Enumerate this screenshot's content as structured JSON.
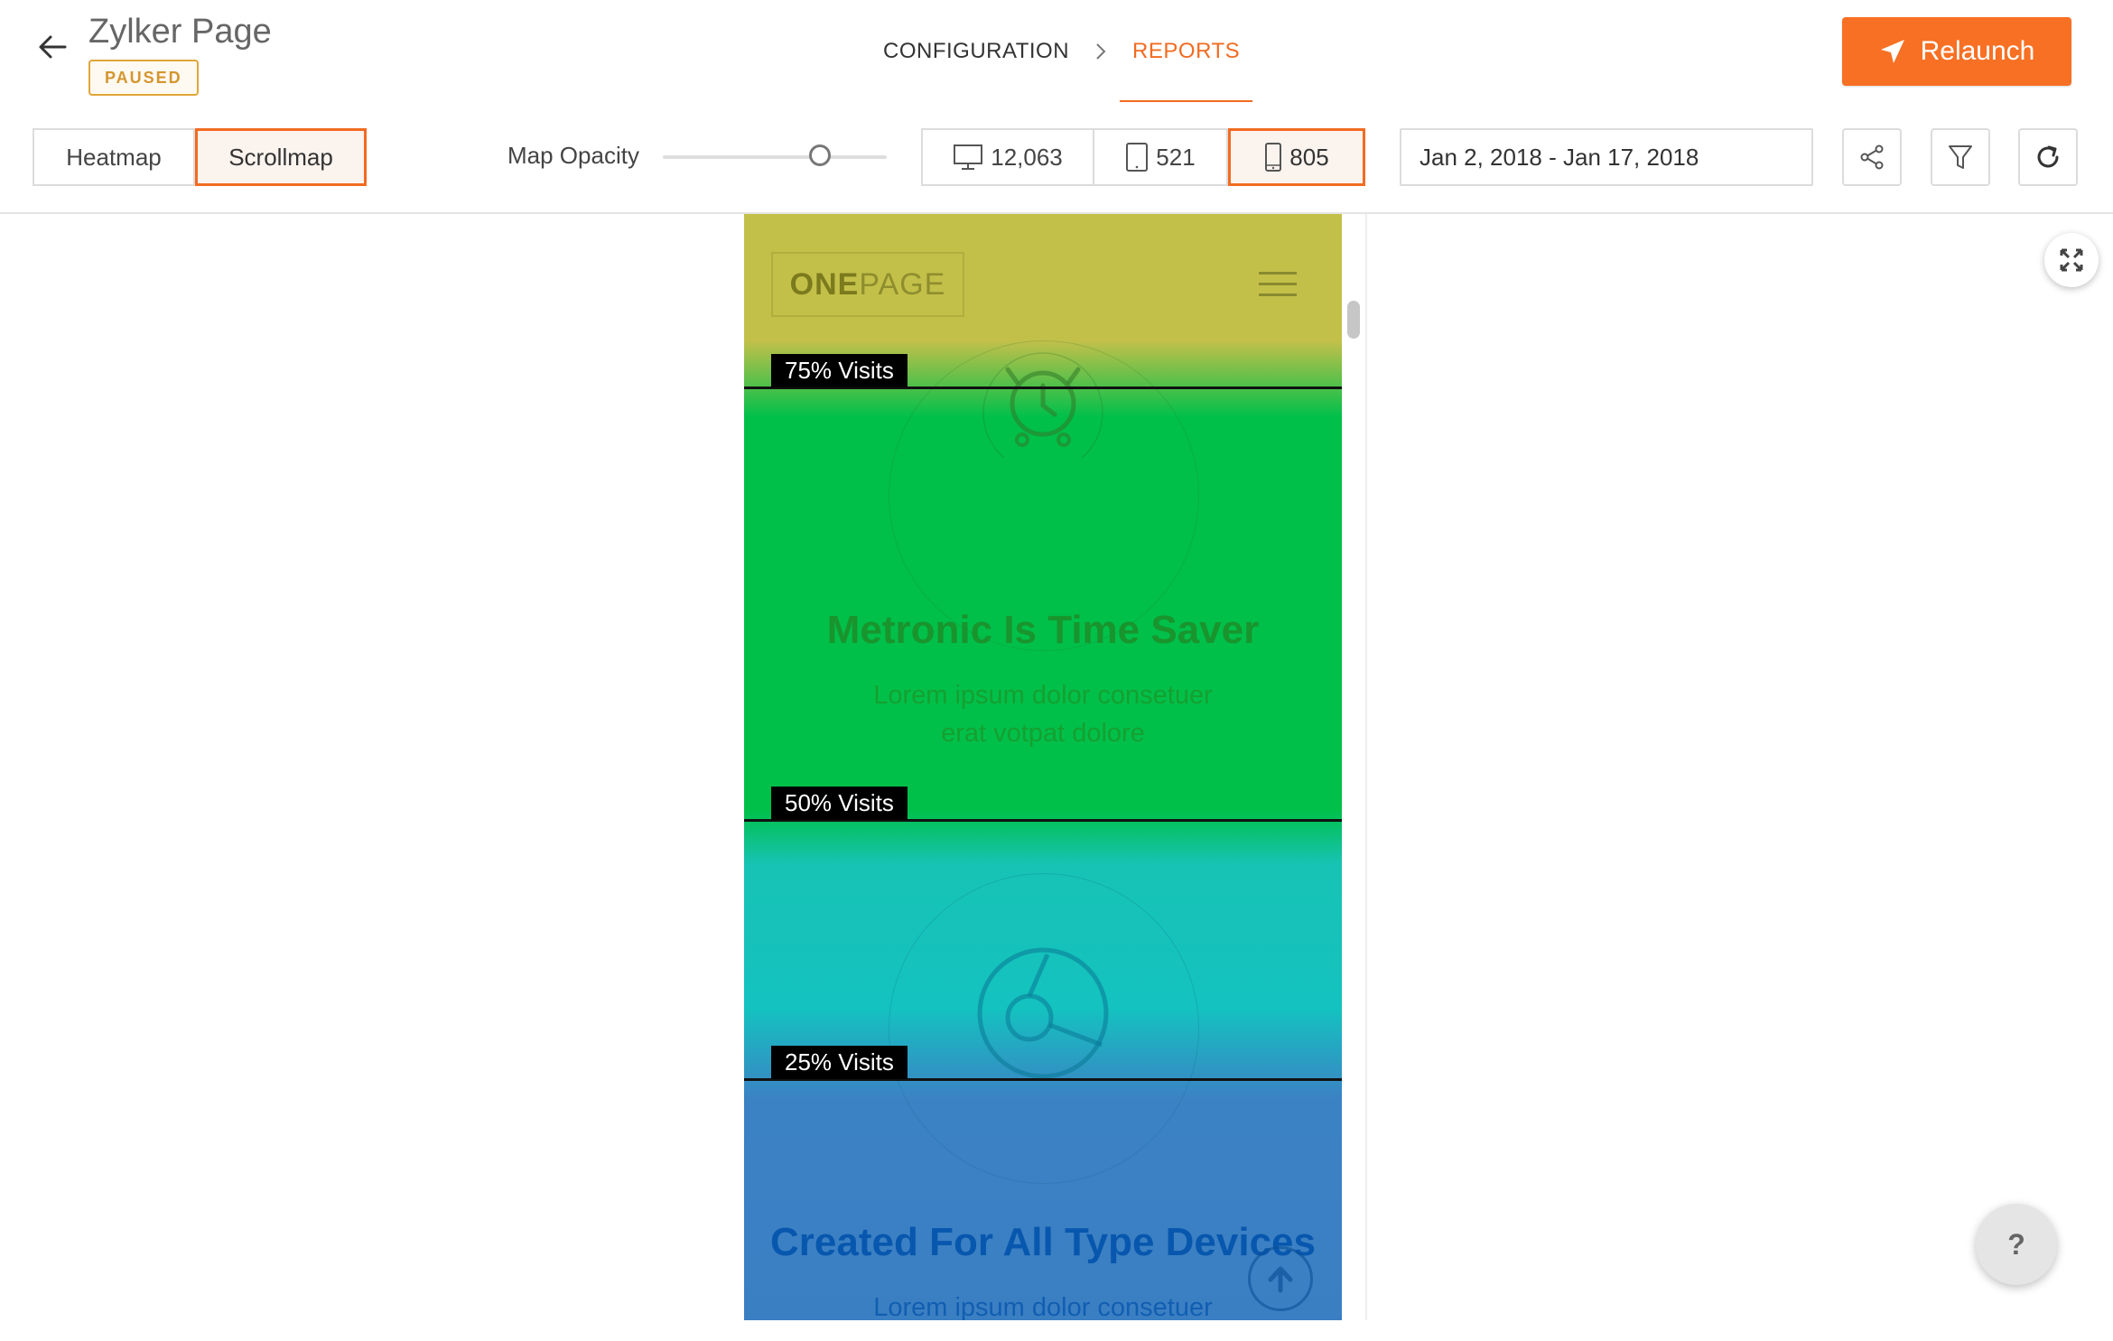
{
  "header": {
    "title": "Zylker Page",
    "status": "PAUSED",
    "nav": [
      {
        "label": "CONFIGURATION",
        "active": false
      },
      {
        "label": "REPORTS",
        "active": true
      }
    ],
    "relaunch_label": "Relaunch",
    "accent_color": "#f26b21"
  },
  "toolbar": {
    "map_types": [
      {
        "label": "Heatmap",
        "active": false
      },
      {
        "label": "Scrollmap",
        "active": true
      }
    ],
    "opacity_label": "Map Opacity",
    "opacity_value": 0.7,
    "devices": [
      {
        "icon": "desktop-icon",
        "count": "12,063",
        "active": false
      },
      {
        "icon": "tablet-icon",
        "count": "521",
        "active": false
      },
      {
        "icon": "mobile-icon",
        "count": "805",
        "active": true
      }
    ],
    "date_range": "Jan 2, 2018 - Jan 17, 2018",
    "actions": [
      "share-icon",
      "filter-icon",
      "refresh-icon"
    ]
  },
  "preview": {
    "logo_bold": "ONE",
    "logo_rest": "PAGE",
    "heading_1": "Metronic Is Time Saver",
    "text_1_line_1": "Lorem ipsum dolor consetuer",
    "text_1_line_2": "erat votpat dolore",
    "heading_2": "Created For All Type Devices",
    "text_2_line_1": "Lorem ipsum dolor consetuer",
    "markers": [
      {
        "label": "75% Visits"
      },
      {
        "label": "50% Visits"
      },
      {
        "label": "25% Visits"
      }
    ],
    "gradient_colors": [
      "#c3c04a",
      "#00c04a",
      "#14c2c0",
      "#3b7fc3"
    ]
  },
  "help_label": "?"
}
